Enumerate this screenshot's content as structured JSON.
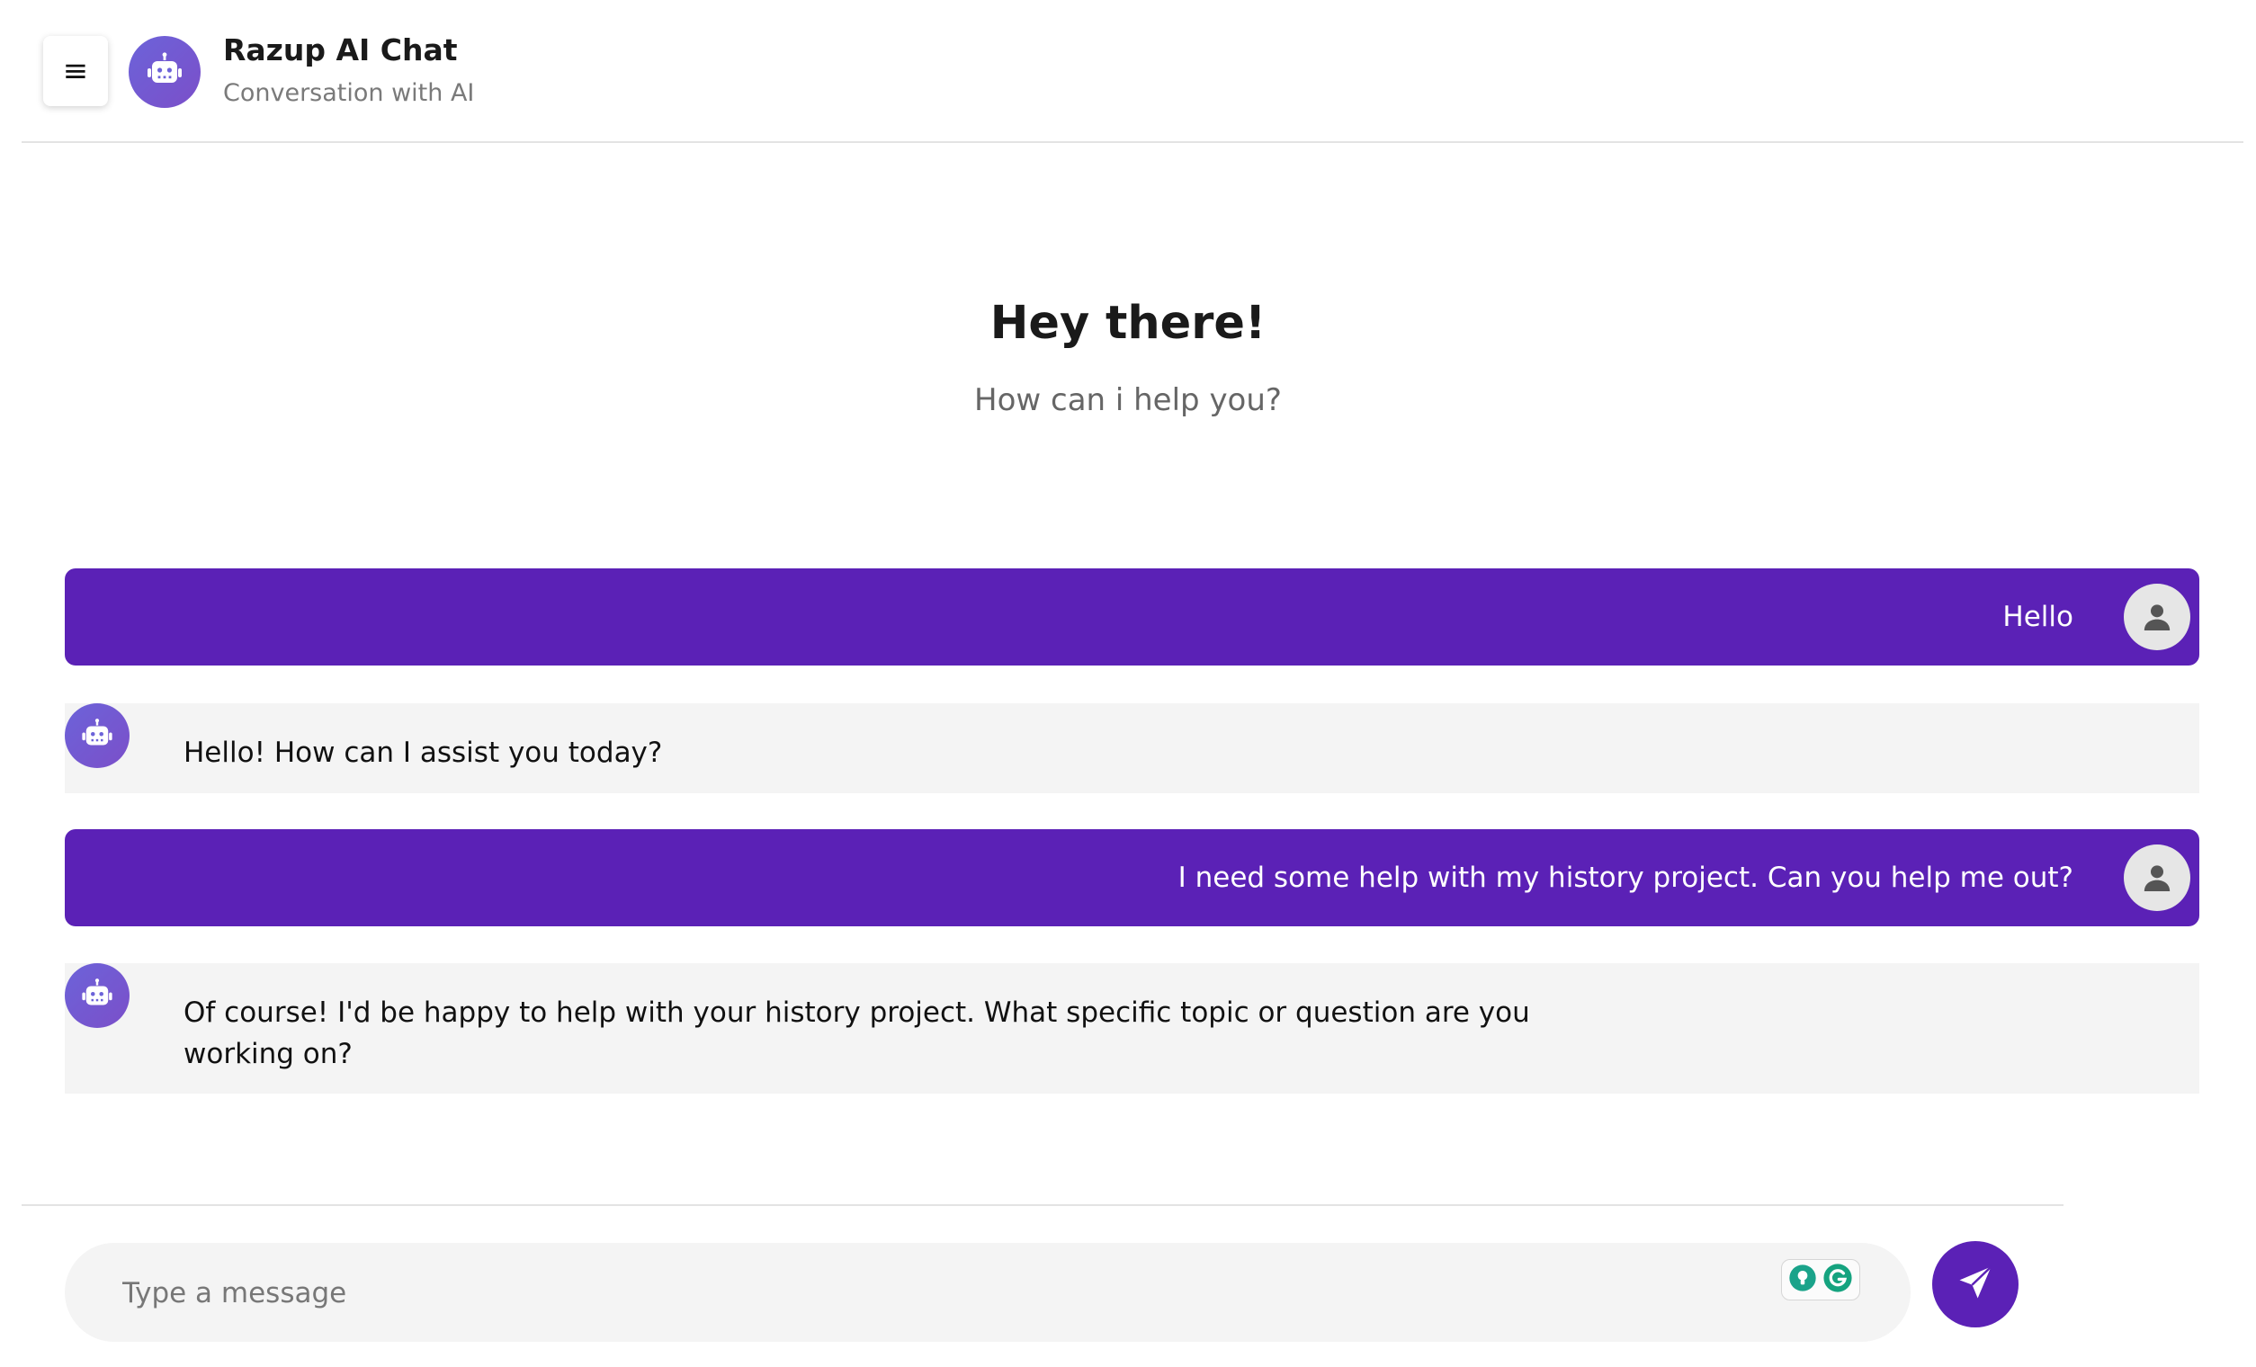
{
  "header": {
    "menu_label": "≡",
    "title": "Razup AI Chat",
    "subtitle": "Conversation with AI"
  },
  "welcome": {
    "title": "Hey there!",
    "subtitle": "How can i help you?"
  },
  "messages": [
    {
      "role": "user",
      "text": "Hello"
    },
    {
      "role": "ai",
      "text": "Hello! How can I assist you today?"
    },
    {
      "role": "user",
      "text": "I need some help with my history project. Can you help me out?"
    },
    {
      "role": "ai",
      "text": "Of course! I'd be happy to help with your history project. What specific topic or question are you working on?"
    }
  ],
  "composer": {
    "placeholder": "Type a message",
    "value": ""
  },
  "colors": {
    "accent": "#5b21b6",
    "bot_avatar": "#6c63d9",
    "ai_bubble": "#f4f4f4",
    "input_bg": "#f4f4f4"
  },
  "icons": {
    "menu": "hamburger-icon",
    "bot": "robot-icon",
    "user": "user-icon",
    "send": "paper-plane-icon",
    "extension_1": "lightbulb-icon",
    "extension_2": "grammarly-icon"
  }
}
